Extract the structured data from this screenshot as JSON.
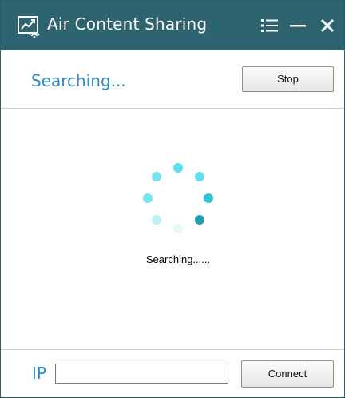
{
  "window": {
    "title": "Air Content Sharing",
    "accent_color": "#2e6470",
    "text_accent_color": "#2a8bc4"
  },
  "titlebar": {
    "icons": [
      "app-logo-icon",
      "menu-icon",
      "minimize-icon",
      "close-icon"
    ]
  },
  "status": {
    "heading": "Searching...",
    "stop_label": "Stop"
  },
  "content": {
    "spinner_icon": "loading-spinner-icon",
    "message": "Searching......"
  },
  "bottom": {
    "ip_label": "IP",
    "ip_value": "",
    "connect_label": "Connect"
  }
}
